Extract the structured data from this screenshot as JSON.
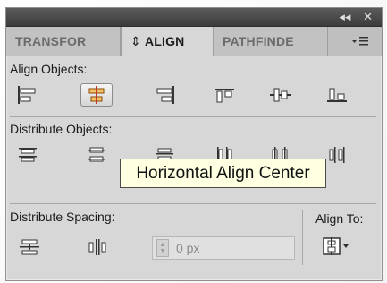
{
  "panel": {
    "window_controls": [
      "◂◂",
      "✕"
    ]
  },
  "tabs": [
    {
      "label": "TRANSFOR"
    },
    {
      "label": "ALIGN",
      "prefix": "⇕"
    },
    {
      "label": "PATHFINDE"
    }
  ],
  "tab_menu_icon": "menu-icon",
  "sections": {
    "align_objects": {
      "label": "Align Objects:",
      "buttons": [
        {
          "name": "horizontal-align-left-icon"
        },
        {
          "name": "horizontal-align-center-icon",
          "hovered": true
        },
        {
          "name": "horizontal-align-right-icon"
        },
        {
          "name": "vertical-align-top-icon"
        },
        {
          "name": "vertical-align-center-icon"
        },
        {
          "name": "vertical-align-bottom-icon"
        }
      ]
    },
    "distribute_objects": {
      "label": "Distribute Objects:",
      "buttons": [
        {
          "name": "vertical-distribute-top-icon"
        },
        {
          "name": "vertical-distribute-center-icon"
        },
        {
          "name": "vertical-distribute-bottom-icon"
        },
        {
          "name": "horizontal-distribute-left-icon"
        },
        {
          "name": "horizontal-distribute-center-icon"
        },
        {
          "name": "horizontal-distribute-right-icon"
        }
      ]
    },
    "distribute_spacing": {
      "label": "Distribute Spacing:",
      "spacing_value": "0 px"
    },
    "align_to": {
      "label": "Align To:"
    }
  },
  "tooltip": {
    "text": "Horizontal Align Center"
  }
}
